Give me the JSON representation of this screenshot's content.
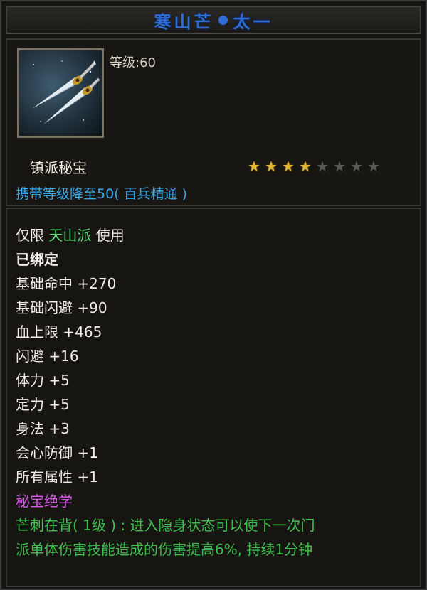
{
  "title": {
    "name": "寒山芒",
    "suffix": "太一",
    "color": "#2f6cd8"
  },
  "item": {
    "icon": "twin-blades-icon",
    "level_label": "等级:60",
    "category": "镇派秘宝",
    "stars_total": 8,
    "stars_filled": 4,
    "carry_level": "携带等级降至50( 百兵精通 )"
  },
  "restriction": {
    "prefix": "仅限",
    "sect": "天山派",
    "suffix": "使用"
  },
  "bound": "已绑定",
  "attributes": [
    {
      "label": "基础命中",
      "value": "+270"
    },
    {
      "label": "基础闪避",
      "value": "+90"
    },
    {
      "label": "血上限",
      "value": "+465"
    },
    {
      "label": "闪避",
      "value": "+16"
    },
    {
      "label": "体力",
      "value": "+5"
    },
    {
      "label": "定力",
      "value": "+5"
    },
    {
      "label": "身法",
      "value": "+3"
    },
    {
      "label": "会心防御",
      "value": "+1"
    },
    {
      "label": "所有属性",
      "value": "+1"
    }
  ],
  "skill_header": "秘宝绝学",
  "skill_desc_1": "芒刺在背( 1级 ) : 进入隐身状态可以使下一次门",
  "skill_desc_2": "派单体伤害技能造成的伤害提高6%, 持续1分钟",
  "colors": {
    "star_on": "#e7b838",
    "star_off": "#5a5a5a",
    "carry": "#38a8e8",
    "sect": "#5ee07a",
    "skill_header": "#d658e6",
    "skill_text": "#3fbf4e"
  }
}
